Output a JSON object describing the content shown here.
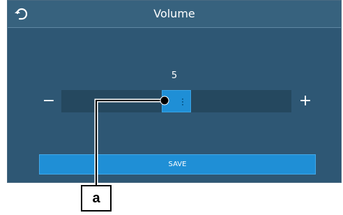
{
  "header": {
    "title": "Volume",
    "back_icon": "back-arrow-icon"
  },
  "volume": {
    "value_text": "5",
    "value": 5,
    "min_label": "−",
    "max_label": "+"
  },
  "actions": {
    "save_label": "SAVE"
  },
  "annotation": {
    "label": "a"
  },
  "colors": {
    "screen_bg": "#2e5774",
    "header_bg": "#37627e",
    "track_bg": "#25485f",
    "accent": "#1f8fd6"
  }
}
